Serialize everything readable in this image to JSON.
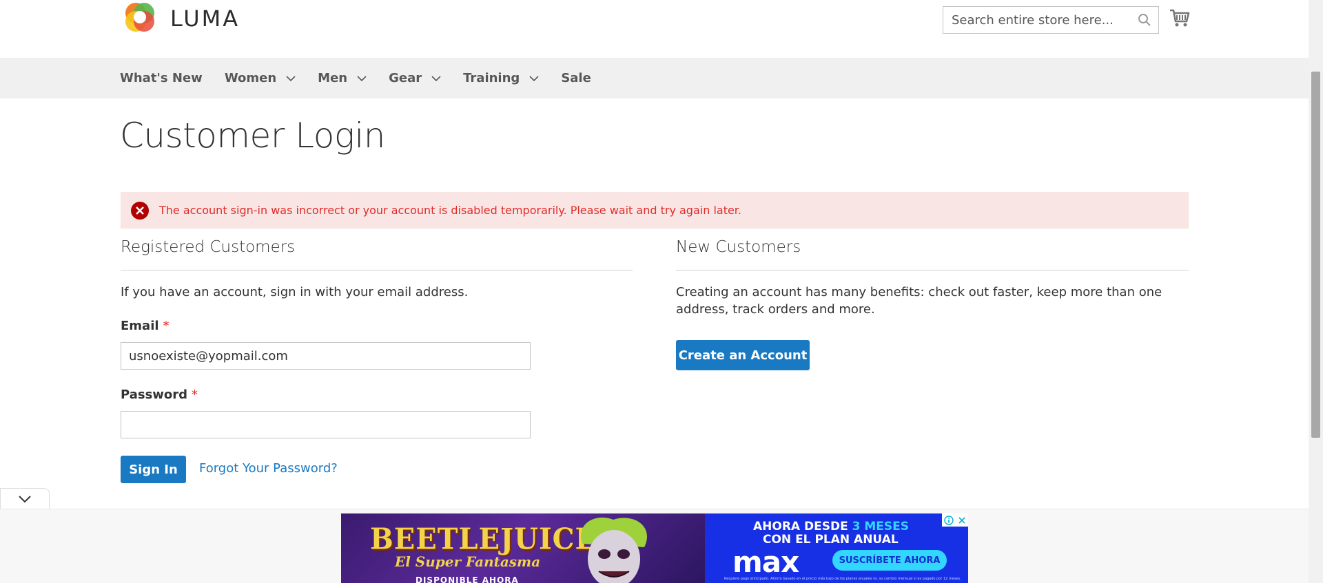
{
  "header": {
    "logo_text": "LUMA",
    "search_placeholder": "Search entire store here...",
    "cart_icon": "cart-icon",
    "search_icon": "search-icon"
  },
  "nav": {
    "items": [
      {
        "label": "What's New",
        "has_dropdown": false
      },
      {
        "label": "Women",
        "has_dropdown": true
      },
      {
        "label": "Men",
        "has_dropdown": true
      },
      {
        "label": "Gear",
        "has_dropdown": true
      },
      {
        "label": "Training",
        "has_dropdown": true
      },
      {
        "label": "Sale",
        "has_dropdown": false
      }
    ]
  },
  "page": {
    "title": "Customer Login",
    "error_message": "The account sign-in was incorrect or your account is disabled temporarily. Please wait and try again later."
  },
  "registered": {
    "title": "Registered Customers",
    "intro": "If you have an account, sign in with your email address.",
    "email_label": "Email",
    "email_value": "usnoexiste@yopmail.com",
    "password_label": "Password",
    "password_value": "",
    "required_mark": "*",
    "sign_in_label": "Sign In",
    "forgot_label": "Forgot Your Password?"
  },
  "new_customers": {
    "title": "New Customers",
    "intro": "Creating an account has many benefits: check out faster, keep more than one address, track orders and more.",
    "create_label": "Create an Account"
  },
  "ad": {
    "title": "BEETLEJUICE",
    "subtitle": "El Super Fantasma",
    "availability": "DISPONIBLE AHORA",
    "headline_prefix": "AHORA DESDE ",
    "headline_accent": "3 MESES",
    "headline_line2": "CON EL PLAN ANUAL",
    "brand": "max",
    "cta": "SUSCRÍBETE AHORA",
    "fine_print": "Requiere pago anticipado. Ahorro basado en el precio más bajo de los planes anuales vs. su cambio mensual si es pagado por 12 meses."
  },
  "colors": {
    "accent": "#1979c3",
    "error_bg": "#fae5e5",
    "error_text": "#e02b27",
    "nav_bg": "#f0f0f0"
  }
}
